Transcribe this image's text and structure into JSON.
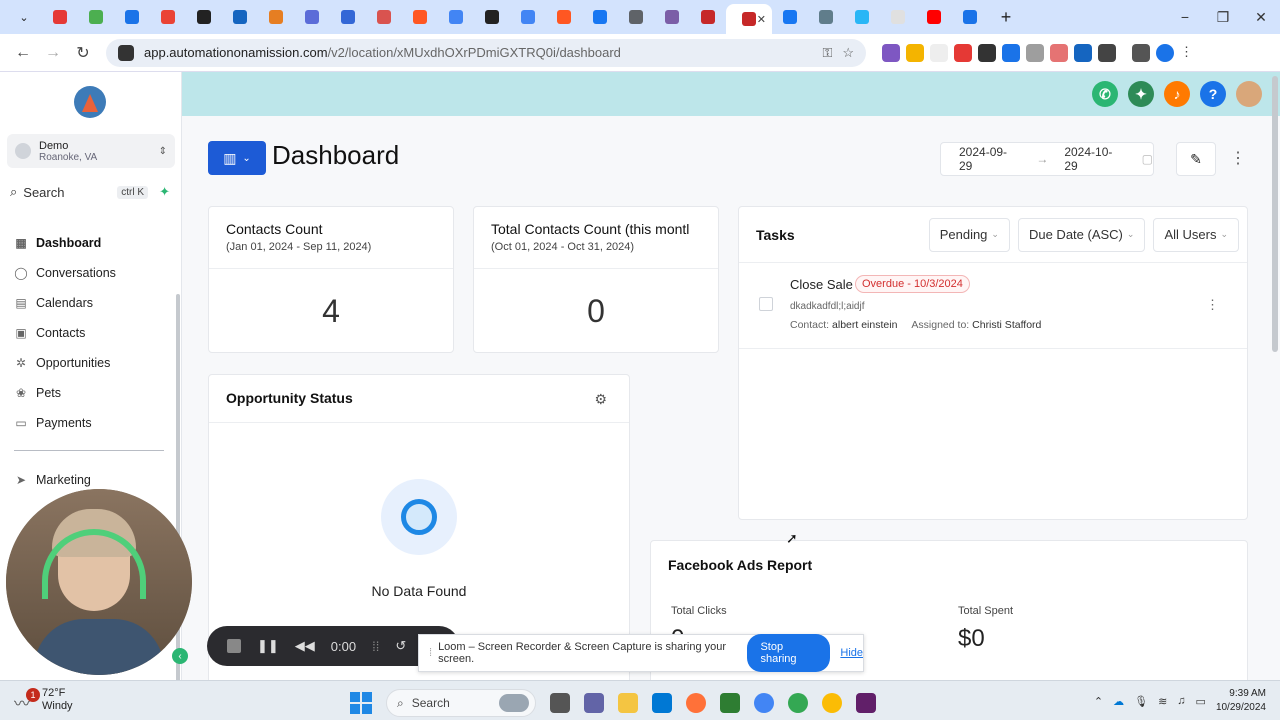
{
  "browser": {
    "url_host": "app.automationonamission.com",
    "url_path": "/v2/location/xMUxdhOXrPDmiGXTRQ0i/dashboard",
    "tab_colors": [
      "#e53935",
      "#4caf50",
      "#1a73e8",
      "#ea4335",
      "#222222",
      "#1565c0",
      "#e67e22",
      "#5b6cd8",
      "#3367d6",
      "#d9534f",
      "#ff5722",
      "#4285f4",
      "#222222",
      "#4285f4",
      "#ff5722",
      "#1877f2",
      "#5f6368",
      "#7b5ea7",
      "#c62828",
      "#c62828",
      "#1877f2",
      "#607d8b",
      "#29b6f6",
      "#e0e0e0",
      "#ff0000",
      "#1a73e8"
    ],
    "active_tab_index": 19,
    "window_controls": [
      "−",
      "❐",
      "✕"
    ]
  },
  "location": {
    "name": "Demo",
    "city": "Roanoke, VA"
  },
  "search": {
    "label": "Search",
    "shortcut": "ctrl K"
  },
  "nav": [
    {
      "label": "Dashboard",
      "icon": "dashboard-icon",
      "glyph": "▦",
      "active": true
    },
    {
      "label": "Conversations",
      "icon": "chat-icon",
      "glyph": "◯",
      "active": false
    },
    {
      "label": "Calendars",
      "icon": "calendar-icon",
      "glyph": "▤",
      "active": false
    },
    {
      "label": "Contacts",
      "icon": "contacts-icon",
      "glyph": "▣",
      "active": false
    },
    {
      "label": "Opportunities",
      "icon": "opportunities-icon",
      "glyph": "✲",
      "active": false
    },
    {
      "label": "Pets",
      "icon": "pets-icon",
      "glyph": "❀",
      "active": false
    },
    {
      "label": "Payments",
      "icon": "payments-icon",
      "glyph": "▭",
      "active": false
    }
  ],
  "nav2": [
    {
      "label": "Marketing",
      "icon": "marketing-icon",
      "glyph": "➤"
    }
  ],
  "header_icons": [
    {
      "name": "phone-icon",
      "color": "#2bb673",
      "glyph": "✆"
    },
    {
      "name": "megaphone-icon",
      "color": "#2e8b57",
      "glyph": "✦"
    },
    {
      "name": "bell-icon",
      "color": "#ff7a00",
      "glyph": "♪"
    },
    {
      "name": "help-icon",
      "color": "#1a73e8",
      "glyph": "?"
    }
  ],
  "page": {
    "title": "Dashboard",
    "date_from": "2024-09-29",
    "date_to": "2024-10-29"
  },
  "cards": {
    "contacts": {
      "title": "Contacts Count",
      "range": "(Jan 01, 2024 - Sep 11, 2024)",
      "value": "4"
    },
    "total_contacts": {
      "title": "Total Contacts Count (this montl",
      "range": "(Oct 01, 2024 - Oct 31, 2024)",
      "value": "0"
    },
    "opportunity": {
      "title": "Opportunity Status",
      "empty": "No Data Found"
    },
    "facebook": {
      "title": "Facebook Ads Report",
      "clicks_label": "Total Clicks",
      "clicks_value": "0",
      "spent_label": "Total Spent",
      "spent_value": "$0"
    }
  },
  "tasks": {
    "title": "Tasks",
    "filters": [
      "Pending",
      "Due Date (ASC)",
      "All Users"
    ],
    "items": [
      {
        "name": "Close Sale",
        "overdue": "Overdue - 10/3/2024",
        "desc": "dkadkadfdl;l;aidjf",
        "contact_label": "Contact:",
        "contact": "albert einstein",
        "assigned_label": "Assigned to:",
        "assigned": "Christi Stafford"
      }
    ]
  },
  "loom": {
    "timer": "0:00",
    "message": "Loom – Screen Recorder & Screen Capture is sharing your screen.",
    "stop": "Stop sharing",
    "hide": "Hide"
  },
  "taskbar": {
    "badge": "1",
    "temp": "72°F",
    "weather": "Windy",
    "search": "Search",
    "time": "9:39 AM",
    "date": "10/29/2024"
  },
  "colors": {
    "brand_blue": "#1d5bd6",
    "header_teal": "#bde6ea",
    "overdue_red": "#d32f2f"
  }
}
